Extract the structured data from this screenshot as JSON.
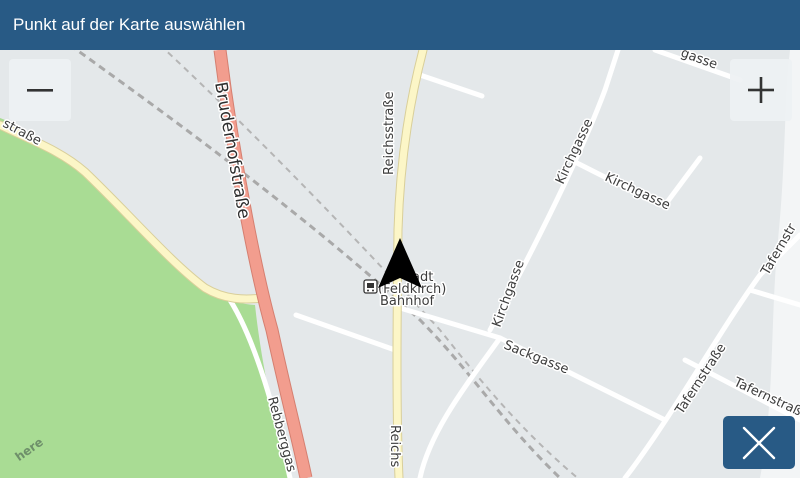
{
  "header": {
    "title": "Punkt auf der Karte auswählen"
  },
  "controls": {
    "zoom_out_icon": "minus-icon",
    "zoom_in_icon": "plus-icon",
    "close_icon": "close-icon"
  },
  "streets": {
    "bruderhofstrasse": "Bruderhofstraße",
    "reichsstrasse_top": "Reichsstraße",
    "reichsstrasse_bottom": "Reichs",
    "strasse_left": "straße",
    "kirchgasse_a": "Kirchgasse",
    "kirchgasse_b": "Kirchgasse",
    "kirchgasse_c": "Kirchgasse",
    "sackgasse": "Sackgasse",
    "tafernstrasse_a": "Tafernstraße",
    "tafernstrasse_b": "Tafernstraße",
    "tafernstrasse_c": "Tafernstr",
    "rebberggasse": "Rebberggas",
    "top_right_gasse": "gasse"
  },
  "poi": {
    "line1": "adt",
    "line2": "(Feldkirch)",
    "line3": "Bahnhof",
    "icon": "train-station-icon"
  },
  "position_marker": {
    "icon": "navigation-arrow-icon"
  },
  "attribution": {
    "text": "here"
  },
  "colors": {
    "header_bg": "#285a85",
    "map_bg": "#e4e8ea",
    "park": "#a9dc94",
    "main_road": "#f29d8e",
    "secondary_road": "#fcf6c7",
    "minor_road": "#ffffff",
    "railway": "#a6a6a6"
  }
}
